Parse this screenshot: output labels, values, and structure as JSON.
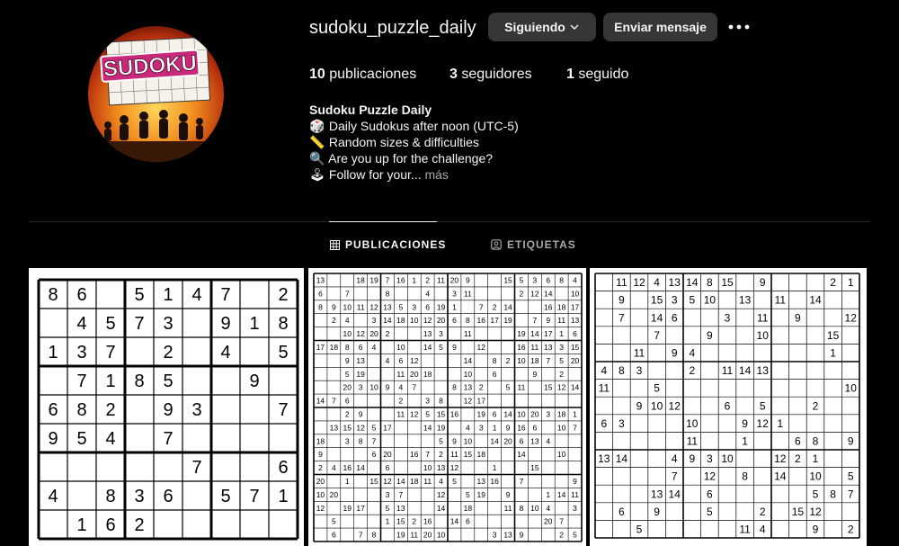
{
  "profile": {
    "username": "sudoku_puzzle_daily",
    "avatar_logo_text": "SUDOKU",
    "buttons": {
      "follow": "Siguiendo",
      "message": "Enviar mensaje"
    },
    "stats": {
      "posts_count": "10",
      "posts_label": " publicaciones",
      "followers_count": "3",
      "followers_label": " seguidores",
      "following_count": "1",
      "following_label": " seguido"
    },
    "bio": {
      "name": "Sudoku Puzzle Daily",
      "lines": [
        {
          "emoji": "🎲",
          "text": "Daily Sudokus after noon (UTC-5)"
        },
        {
          "emoji": "📏",
          "text": "Random sizes & difficulties"
        },
        {
          "emoji": "🔍",
          "text": "Are you up for the challenge?"
        },
        {
          "emoji": "🕹",
          "text": "Follow for your..."
        }
      ],
      "more": "más"
    }
  },
  "tabs": [
    {
      "label": "PUBLICACIONES",
      "icon": "grid-icon",
      "active": true
    },
    {
      "label": "ETIQUETAS",
      "icon": "tag-icon",
      "active": false
    }
  ],
  "posts": [
    {
      "size": 9,
      "rows": [
        [
          "8",
          "6",
          "",
          "5",
          "1",
          "4",
          "7",
          "",
          "2"
        ],
        [
          "",
          "4",
          "5",
          "7",
          "3",
          "",
          "9",
          "1",
          "8"
        ],
        [
          "1",
          "3",
          "7",
          "",
          "2",
          "",
          "4",
          "",
          "5"
        ],
        [
          "",
          "7",
          "1",
          "8",
          "5",
          "",
          "",
          "9",
          ""
        ],
        [
          "6",
          "8",
          "2",
          "",
          "9",
          "3",
          "",
          "",
          "7"
        ],
        [
          "9",
          "5",
          "4",
          "",
          "7",
          "",
          "",
          "",
          ""
        ],
        [
          "",
          "",
          "",
          "",
          "",
          "7",
          "",
          "",
          "6"
        ],
        [
          "4",
          "",
          "8",
          "3",
          "6",
          "",
          "5",
          "7",
          "1"
        ],
        [
          "",
          "1",
          "6",
          "2",
          "",
          "",
          "",
          "",
          ""
        ]
      ]
    },
    {
      "size": 20,
      "rows": [
        [
          "13",
          "",
          "",
          "18",
          "19",
          "7",
          "16",
          "1",
          "2",
          "11",
          "20",
          "9",
          "",
          "",
          "15",
          "5",
          "3",
          "6",
          "8",
          "4"
        ],
        [
          "6",
          "",
          "7",
          "",
          "",
          "8",
          "",
          "",
          "4",
          "",
          "3",
          "11",
          "",
          "",
          "",
          "2",
          "12",
          "14",
          "",
          "10"
        ],
        [
          "8",
          "9",
          "10",
          "11",
          "12",
          "13",
          "5",
          "3",
          "6",
          "19",
          "1",
          "",
          "7",
          "2",
          "14",
          "",
          "",
          "16",
          "18",
          "17"
        ],
        [
          "",
          "2",
          "4",
          "",
          "3",
          "14",
          "18",
          "10",
          "12",
          "20",
          "6",
          "8",
          "16",
          "17",
          "19",
          "",
          "7",
          "9",
          "11",
          "13"
        ],
        [
          "",
          "",
          "10",
          "12",
          "20",
          "2",
          "",
          "",
          "13",
          "3",
          "",
          "11",
          "",
          "",
          "",
          "19",
          "14",
          "17",
          "1",
          "6"
        ],
        [
          "17",
          "18",
          "8",
          "6",
          "4",
          "",
          "10",
          "",
          "14",
          "5",
          "9",
          "",
          "12",
          "",
          "",
          "16",
          "11",
          "13",
          "3",
          "15"
        ],
        [
          "",
          "",
          "9",
          "13",
          "",
          "4",
          "6",
          "12",
          "",
          "",
          "",
          "14",
          "",
          "8",
          "2",
          "10",
          "18",
          "7",
          "5",
          "20"
        ],
        [
          "",
          "",
          "5",
          "19",
          "",
          "",
          "11",
          "20",
          "18",
          "",
          "",
          "10",
          "",
          "6",
          "",
          "",
          "9",
          "",
          "2",
          ""
        ],
        [
          "",
          "",
          "20",
          "3",
          "10",
          "9",
          "4",
          "7",
          "",
          "",
          "8",
          "13",
          "2",
          "",
          "5",
          "11",
          "",
          "15",
          "12",
          "14"
        ],
        [
          "14",
          "7",
          "6",
          "",
          "",
          "",
          "2",
          "",
          "3",
          "8",
          "",
          "12",
          "17",
          "",
          "",
          "",
          "",
          "",
          "",
          ""
        ],
        [
          "",
          "",
          "2",
          "9",
          "",
          "",
          "11",
          "12",
          "5",
          "15",
          "16",
          "",
          "19",
          "6",
          "14",
          "10",
          "20",
          "3",
          "18",
          "1"
        ],
        [
          "",
          "13",
          "15",
          "12",
          "5",
          "17",
          "",
          "",
          "14",
          "19",
          "",
          "4",
          "3",
          "1",
          "9",
          "16",
          "6",
          "",
          "10",
          "7"
        ],
        [
          "18",
          "",
          "3",
          "8",
          "7",
          "",
          "",
          "",
          "",
          "5",
          "9",
          "10",
          "",
          "14",
          "20",
          "6",
          "13",
          "4",
          "",
          ""
        ],
        [
          "9",
          "",
          "",
          "",
          "6",
          "20",
          "",
          "16",
          "7",
          "2",
          "11",
          "15",
          "18",
          "",
          "",
          "14",
          "",
          "",
          "10",
          ""
        ],
        [
          "2",
          "4",
          "16",
          "14",
          "",
          "6",
          "",
          "",
          "10",
          "13",
          "12",
          "",
          "",
          "1",
          "",
          "",
          "15",
          "",
          "",
          ""
        ],
        [
          "20",
          "",
          "1",
          "",
          "15",
          "12",
          "14",
          "18",
          "11",
          "4",
          "5",
          "",
          "13",
          "16",
          "",
          "7",
          "",
          "",
          "",
          "9"
        ],
        [
          "10",
          "20",
          "",
          "",
          "",
          "3",
          "7",
          "",
          "",
          "12",
          "",
          "5",
          "19",
          "",
          "9",
          "",
          "",
          "1",
          "14",
          "11"
        ],
        [
          "12",
          "",
          "19",
          "17",
          "",
          "5",
          "13",
          "",
          "",
          "14",
          "",
          "18",
          "",
          "",
          "11",
          "8",
          "10",
          "4",
          "",
          "3"
        ],
        [
          "",
          "5",
          "",
          "",
          "",
          "1",
          "15",
          "2",
          "16",
          "",
          "14",
          "6",
          "",
          "",
          "",
          "",
          "",
          "20",
          "7",
          ""
        ],
        [
          "",
          "6",
          "",
          "7",
          "8",
          "",
          "19",
          "11",
          "20",
          "10",
          "",
          "",
          "",
          "3",
          "13",
          "9",
          "",
          "",
          "2",
          "5"
        ]
      ]
    },
    {
      "size": 15,
      "rows": [
        [
          "",
          "11",
          "12",
          "4",
          "13",
          "14",
          "8",
          "15",
          "",
          "9",
          "",
          "",
          "",
          "2",
          "1"
        ],
        [
          "",
          "9",
          "",
          "15",
          "3",
          "5",
          "10",
          "",
          "13",
          "",
          "11",
          "",
          "14",
          "",
          ""
        ],
        [
          "",
          "7",
          "",
          "14",
          "6",
          "",
          "",
          "3",
          "",
          "11",
          "",
          "9",
          "",
          "",
          "12"
        ],
        [
          "",
          "",
          "",
          "7",
          "",
          "",
          "9",
          "",
          "",
          "10",
          "",
          "",
          "",
          "15",
          ""
        ],
        [
          "",
          "",
          "11",
          "",
          "9",
          "4",
          "",
          "",
          "",
          "",
          "",
          "",
          "",
          "1",
          ""
        ],
        [
          "4",
          "8",
          "3",
          "",
          "",
          "2",
          "",
          "11",
          "14",
          "13",
          "",
          "",
          "",
          "",
          ""
        ],
        [
          "11",
          "",
          "",
          "5",
          "",
          "",
          "",
          "",
          "",
          "",
          "",
          "",
          "",
          "",
          "10"
        ],
        [
          "",
          "",
          "9",
          "10",
          "12",
          "",
          "",
          "6",
          "",
          "5",
          "",
          "",
          "2",
          "",
          ""
        ],
        [
          "6",
          "3",
          "",
          "",
          "",
          "10",
          "",
          "",
          "9",
          "12",
          "1",
          "",
          "",
          "",
          ""
        ],
        [
          "",
          "",
          "",
          "",
          "",
          "11",
          "",
          "",
          "1",
          "",
          "",
          "6",
          "8",
          "",
          "9"
        ],
        [
          "13",
          "14",
          "",
          "",
          "4",
          "9",
          "3",
          "10",
          "",
          "",
          "12",
          "2",
          "1",
          "",
          ""
        ],
        [
          "",
          "",
          "",
          "",
          "7",
          "",
          "12",
          "",
          "8",
          "",
          "14",
          "",
          "10",
          "",
          "5"
        ],
        [
          "",
          "",
          "",
          "13",
          "14",
          "",
          "6",
          "",
          "",
          "",
          "",
          "",
          "5",
          "8",
          "7"
        ],
        [
          "",
          "6",
          "",
          "9",
          "",
          "",
          "5",
          "",
          "",
          "2",
          "",
          "15",
          "12",
          "",
          ""
        ],
        [
          "",
          "",
          "5",
          "",
          "",
          "",
          "",
          "",
          "11",
          "4",
          "",
          "",
          "9",
          "",
          "2"
        ]
      ]
    }
  ]
}
